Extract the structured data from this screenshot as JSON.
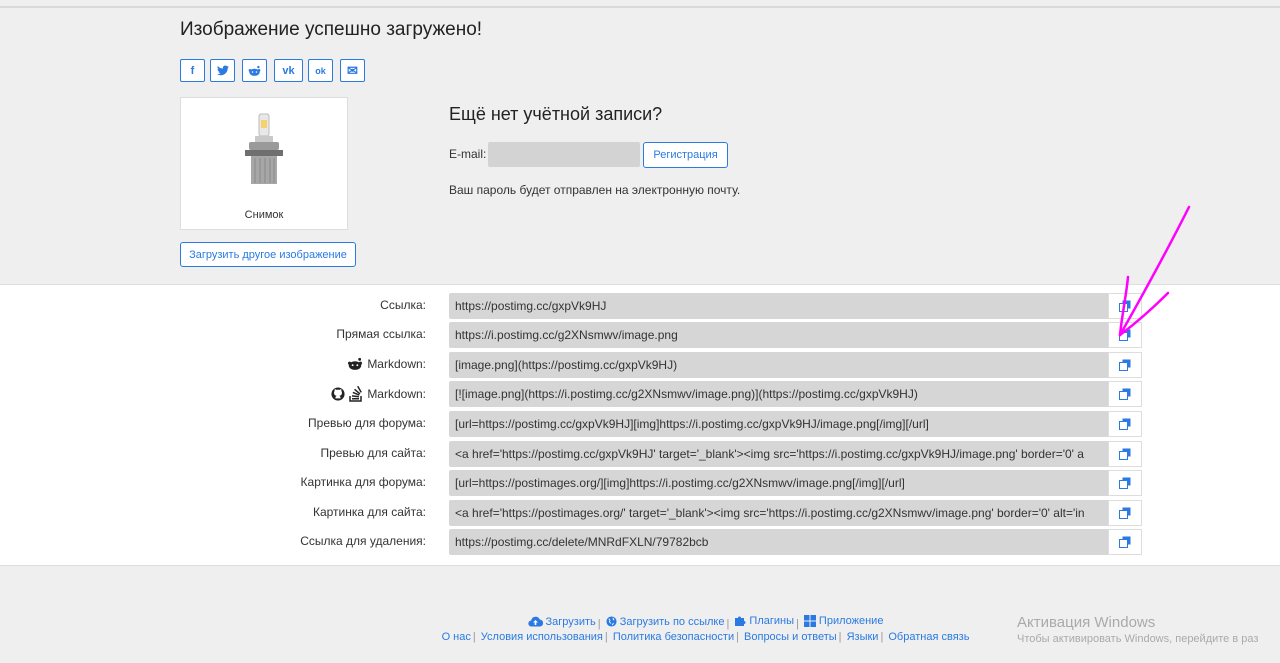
{
  "header": {
    "title": "Изображение успешно загружено!"
  },
  "social": [
    {
      "icon": "facebook-icon",
      "glyph": "f"
    },
    {
      "icon": "twitter-icon",
      "glyph": "t"
    },
    {
      "icon": "reddit-icon",
      "glyph": "r"
    },
    {
      "icon": "vk-icon",
      "glyph": "vk"
    },
    {
      "icon": "odnoklassniki-icon",
      "glyph": "ok"
    },
    {
      "icon": "email-icon",
      "glyph": "✉"
    }
  ],
  "preview": {
    "caption": "Снимок"
  },
  "upload_other_label": "Загрузить другое изображение",
  "registration": {
    "title": "Ещё нет учётной записи?",
    "email_label": "E-mail:",
    "email_value": "",
    "button_label": "Регистрация",
    "note": "Ваш пароль будет отправлен на электронную почту."
  },
  "links": [
    {
      "label": "Ссылка:",
      "value": "https://postimg.cc/gxpVk9HJ"
    },
    {
      "label": "Прямая ссылка:",
      "value": "https://i.postimg.cc/g2XNsmwv/image.png"
    },
    {
      "label": "Markdown:",
      "value": "[image.png](https://postimg.cc/gxpVk9HJ)"
    },
    {
      "label": "Markdown:",
      "value": "[![image.png](https://i.postimg.cc/g2XNsmwv/image.png)](https://postimg.cc/gxpVk9HJ)"
    },
    {
      "label": "Превью для форума:",
      "value": "[url=https://postimg.cc/gxpVk9HJ][img]https://i.postimg.cc/gxpVk9HJ/image.png[/img][/url]"
    },
    {
      "label": "Превью для сайта:",
      "value": "<a href='https://postimg.cc/gxpVk9HJ' target='_blank'><img src='https://i.postimg.cc/gxpVk9HJ/image.png' border='0' a"
    },
    {
      "label": "Картинка для форума:",
      "value": "[url=https://postimages.org/][img]https://i.postimg.cc/g2XNsmwv/image.png[/img][/url]"
    },
    {
      "label": "Картинка для сайта:",
      "value": "<a href='https://postimages.org/' target='_blank'><img src='https://i.postimg.cc/g2XNsmwv/image.png' border='0' alt='in"
    },
    {
      "label": "Ссылка для удаления:",
      "value": "https://postimg.cc/delete/MNRdFXLN/79782bcb"
    }
  ],
  "footer": {
    "row1": [
      "Загрузить",
      "Загрузить по ссылке",
      "Плагины",
      "Приложение"
    ],
    "row2": [
      "О нас",
      "Условия использования",
      "Политика безопасности",
      "Вопросы и ответы",
      "Языки",
      "Обратная связь"
    ]
  },
  "windows_watermark": {
    "title": "Активация Windows",
    "subtitle": "Чтобы активировать Windows, перейдите в раз"
  },
  "colors": {
    "accent": "#2a7ae2",
    "annotation": "#ff00ff"
  }
}
